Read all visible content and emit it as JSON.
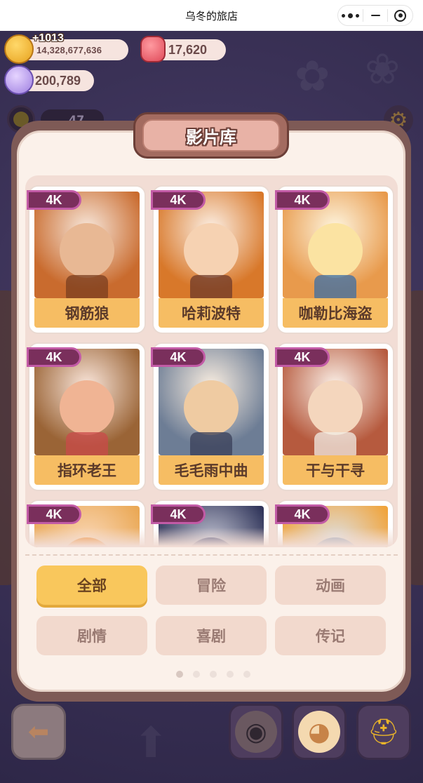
{
  "window": {
    "title": "乌冬的旅店"
  },
  "currencies": {
    "coin_bonus": "+1013",
    "coins": "14,328,677,636",
    "gems": "17,620",
    "shells": "200,789"
  },
  "hud": {
    "level_value": "47"
  },
  "panel": {
    "title": "影片库"
  },
  "movies": [
    {
      "badge": "4K",
      "title": "钢筋狼",
      "bg": "#c96b2e",
      "fig": "#e8b894",
      "fig2": "#7a3e1f"
    },
    {
      "badge": "4K",
      "title": "哈莉波特",
      "bg": "#d8782a",
      "fig": "#f6d2b2",
      "fig2": "#6e3a2a"
    },
    {
      "badge": "4K",
      "title": "咖勒比海盗",
      "bg": "#e89a4c",
      "fig": "#fbe3a2",
      "fig2": "#3b6ea6"
    },
    {
      "badge": "4K",
      "title": "指环老王",
      "bg": "#9a6436",
      "fig": "#f0b494",
      "fig2": "#c94a4a"
    },
    {
      "badge": "4K",
      "title": "毛毛雨中曲",
      "bg": "#6d7d95",
      "fig": "#efcba2",
      "fig2": "#3a3f58"
    },
    {
      "badge": "4K",
      "title": "干与干寻",
      "bg": "#b65a3e",
      "fig": "#f4d6bd",
      "fig2": "#f1ece4"
    },
    {
      "badge": "4K",
      "title": "",
      "bg": "#eaa855",
      "fig": "#f08a2a",
      "fig2": "#3a7a3a"
    },
    {
      "badge": "4K",
      "title": "",
      "bg": "#30355a",
      "fig": "#4a4f7a",
      "fig2": "#23264a"
    },
    {
      "badge": "4K",
      "title": "",
      "bg": "#f0a43c",
      "fig": "#9aa7b8",
      "fig2": "#e86a2a"
    }
  ],
  "filters": [
    {
      "label": "全部",
      "active": true
    },
    {
      "label": "冒险",
      "active": false
    },
    {
      "label": "动画",
      "active": false
    },
    {
      "label": "剧情",
      "active": false
    },
    {
      "label": "喜剧",
      "active": false
    },
    {
      "label": "传记",
      "active": false
    }
  ],
  "pagination": {
    "current": 1,
    "total": 5
  },
  "bottom_bar": {
    "icons": [
      "back-arrow-icon",
      "film-reel-icon",
      "duck-chef-icon",
      "hard-hat-icon"
    ]
  }
}
